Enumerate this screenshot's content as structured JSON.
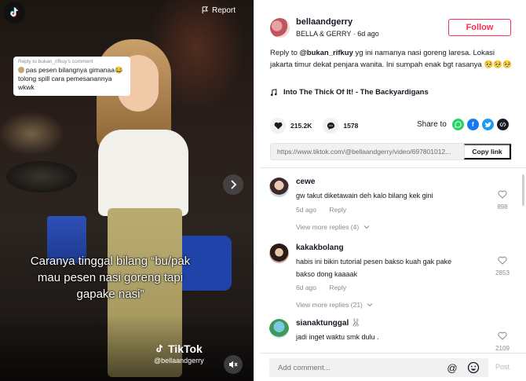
{
  "video": {
    "report_label": "Report",
    "reply_bubble": {
      "header": "Reply to bukan_rifkuy's comment",
      "text": "pas pesen bilangnya gimanaa😂 tolong spill cara pemesanannya wkwk"
    },
    "caption": "Caranya tinggal bilang “bu/pak mau pesen nasi goreng tapi gapake nasi”",
    "watermark_brand": "TikTok",
    "watermark_user": "@bellaandgerry"
  },
  "author": {
    "username": "bellaandgerry",
    "display": "BELLA & GERRY · 6d ago",
    "follow_label": "Follow"
  },
  "post": {
    "reply_prefix": "Reply to ",
    "mention": "@bukan_rifkuy",
    "description": " yg ini namanya nasi goreng laresa. Lokasi jakarta timur dekat penjara wanita. Ini sumpah enak bgt rasanya 🥺🥺🥺",
    "music": "Into The Thick Of It! - The Backyardigans"
  },
  "stats": {
    "likes": "215.2K",
    "comments": "1578",
    "share_label": "Share to"
  },
  "link": {
    "url": "https://www.tiktok.com/@bellaandgerry/video/697801012...",
    "copy_label": "Copy link"
  },
  "comments": [
    {
      "username": "cewe",
      "text": "gw takut diketawain deh kalo bilang kek gini",
      "time": "5d ago",
      "reply_label": "Reply",
      "likes": "898",
      "more": "View more replies (4)"
    },
    {
      "username": "kakakbolang",
      "text_line1": "habis ini bikin tutorial pesen bakso kuah gak pake",
      "text_line2": "bakso dong kaaaak",
      "time": "6d ago",
      "reply_label": "Reply",
      "likes": "2853",
      "more": "View more replies (21)"
    },
    {
      "username": "sianaktunggal 🐰",
      "text": "jadi inget waktu smk dulu .",
      "likes": "2109"
    }
  ],
  "composer": {
    "placeholder": "Add comment...",
    "post_label": "Post"
  },
  "colors": {
    "brand_red": "#fe2c55",
    "text": "#161823",
    "muted": "#8a8b91"
  }
}
